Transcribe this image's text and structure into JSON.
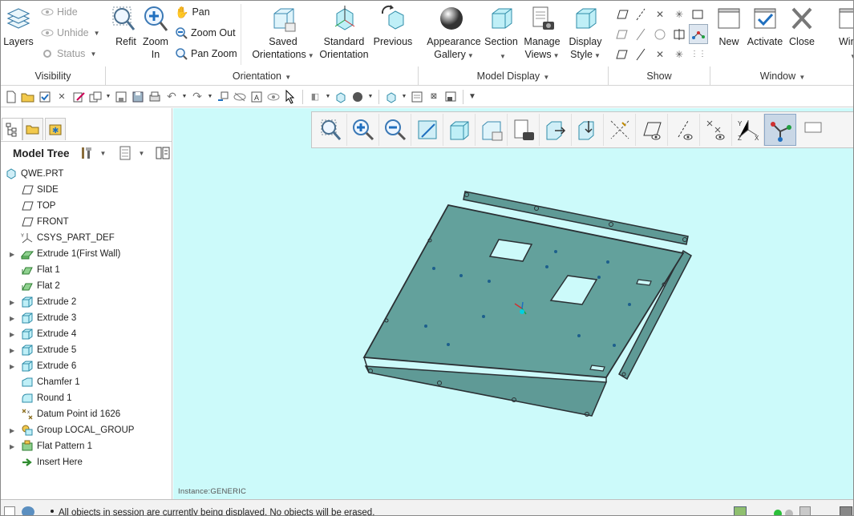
{
  "ribbon": {
    "visibility": {
      "group_label": "Visibility",
      "layers": "Layers",
      "hide": "Hide",
      "unhide": "Unhide",
      "status": "Status"
    },
    "orientation": {
      "group_label": "Orientation",
      "refit": "Refit",
      "zoom_in_top": "Zoom",
      "zoom_in_bot": "In",
      "pan": "Pan",
      "zoom_out": "Zoom Out",
      "pan_zoom": "Pan Zoom",
      "saved_top": "Saved",
      "saved_bot": "Orientations",
      "standard_top": "Standard",
      "standard_bot": "Orientation",
      "previous": "Previous"
    },
    "model_display": {
      "group_label": "Model Display",
      "appearance_top": "Appearance",
      "appearance_bot": "Gallery",
      "section": "Section",
      "manage_top": "Manage",
      "manage_bot": "Views",
      "display_top": "Display",
      "display_bot": "Style"
    },
    "show": {
      "group_label": "Show"
    },
    "window": {
      "group_label": "Window",
      "new": "New",
      "activate": "Activate",
      "close": "Close",
      "windows": "Windo"
    }
  },
  "model_tree": {
    "title": "Model Tree",
    "items": [
      {
        "label": "QWE.PRT",
        "icon": "part-icon",
        "expandable": false,
        "root": true
      },
      {
        "label": "SIDE",
        "icon": "datum-plane-icon",
        "expandable": false
      },
      {
        "label": "TOP",
        "icon": "datum-plane-icon",
        "expandable": false
      },
      {
        "label": "FRONT",
        "icon": "datum-plane-icon",
        "expandable": false
      },
      {
        "label": "CSYS_PART_DEF",
        "icon": "csys-icon",
        "expandable": false
      },
      {
        "label": "Extrude 1(First Wall)",
        "icon": "first-wall-icon",
        "expandable": true
      },
      {
        "label": "Flat 1",
        "icon": "flat-wall-icon",
        "expandable": false
      },
      {
        "label": "Flat 2",
        "icon": "flat-wall-icon",
        "expandable": false
      },
      {
        "label": "Extrude 2",
        "icon": "extrude-icon",
        "expandable": true
      },
      {
        "label": "Extrude 3",
        "icon": "extrude-icon",
        "expandable": true
      },
      {
        "label": "Extrude 4",
        "icon": "extrude-icon",
        "expandable": true
      },
      {
        "label": "Extrude 5",
        "icon": "extrude-icon",
        "expandable": true
      },
      {
        "label": "Extrude 6",
        "icon": "extrude-icon",
        "expandable": true
      },
      {
        "label": "Chamfer 1",
        "icon": "chamfer-icon",
        "expandable": false
      },
      {
        "label": "Round 1",
        "icon": "round-icon",
        "expandable": false
      },
      {
        "label": "Datum Point id 1626",
        "icon": "datum-point-icon",
        "expandable": false
      },
      {
        "label": "Group LOCAL_GROUP",
        "icon": "group-icon",
        "expandable": true
      },
      {
        "label": "Flat Pattern 1",
        "icon": "flat-pattern-icon",
        "expandable": true
      },
      {
        "label": "Insert Here",
        "icon": "insert-arrow-icon",
        "expandable": false
      }
    ]
  },
  "viewport": {
    "instance_label": "Instance:GENERIC"
  },
  "status_bar": {
    "message": "All objects in session are currently being displayed. No objects will be erased."
  },
  "colors": {
    "viewport_bg": "#ccfafa",
    "part_fill": "#5f9a96",
    "part_edge": "#2a2f33",
    "accent": "#1e7fd0"
  }
}
